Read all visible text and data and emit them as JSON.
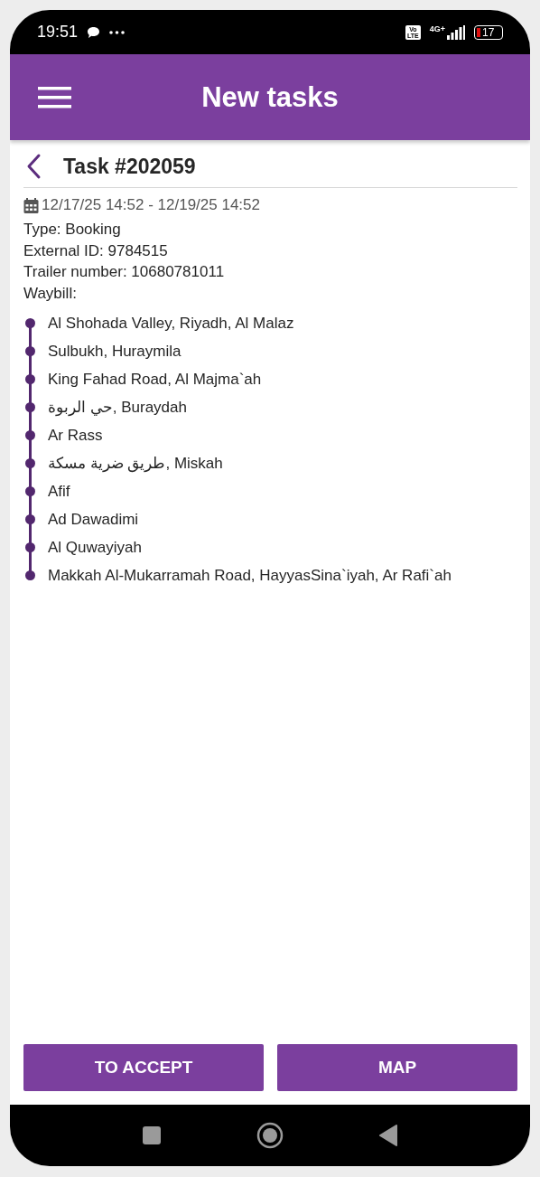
{
  "status_bar": {
    "time": "19:51",
    "volte": [
      "Vo",
      "LTE"
    ],
    "network": "4G+",
    "battery": "17"
  },
  "app_bar": {
    "title": "New tasks"
  },
  "task": {
    "title": "Task #202059",
    "period": "12/17/25 14:52 - 12/19/25 14:52",
    "details": [
      "Type: Booking",
      "External ID: 9784515",
      "Trailer number: 10680781011",
      "Waybill:"
    ],
    "waybill": [
      "Al Shohada Valley, Riyadh, Al Malaz",
      "Sulbukh, Huraymila",
      "King Fahad Road, Al Majma`ah",
      "حي الربوة, Buraydah",
      "Ar Rass",
      "طريق ضرية مسكة, Miskah",
      "Afif",
      "Ad Dawadimi",
      "Al Quwayiyah",
      "Makkah Al-Mukarramah Road, HayyasSina`iyah, Ar Rafi`ah"
    ]
  },
  "buttons": [
    "TO ACCEPT",
    "MAP"
  ]
}
